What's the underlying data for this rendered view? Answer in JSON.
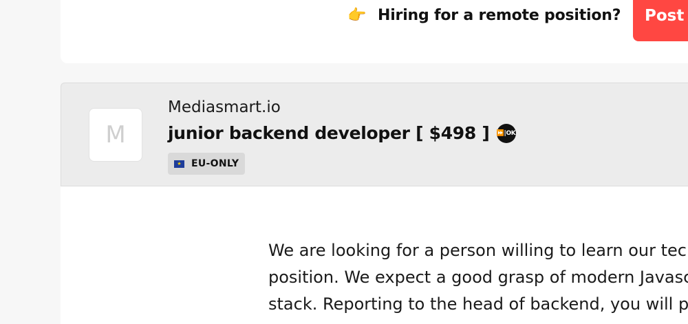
{
  "hiring_banner": {
    "emoji": "👉",
    "text": "Hiring for a remote position?",
    "post_label": "Post"
  },
  "job": {
    "logo_letter": "M",
    "company": "Mediasmart.io",
    "title": "junior backend developer [ $498 ]",
    "badge_text": "⏩|OK",
    "tag": {
      "flag": "★",
      "label": "EU-ONLY"
    }
  },
  "description": {
    "lines": [
      "We are looking for a person willing to learn our tech",
      "position. We expect a good grasp of modern Javascr",
      "stack. Reporting to the head of backend, you will pa"
    ]
  },
  "colors": {
    "post_button": "#ff4742",
    "row_background": "#ececec",
    "tag_background": "#d9d9d9",
    "eu_flag_blue": "#1e3d9a"
  }
}
